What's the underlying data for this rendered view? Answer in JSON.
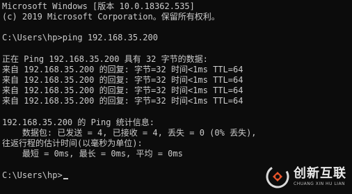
{
  "terminal": {
    "header_line_1": "Microsoft Windows [版本 10.0.18362.535]",
    "header_line_2": "(c) 2019 Microsoft Corporation。保留所有权利。",
    "command_line": "C:\\Users\\hp>ping 192.168.35.200",
    "ping_start": "正在 Ping 192.168.35.200 具有 32 字节的数据:",
    "replies": [
      "来自 192.168.35.200 的回复: 字节=32 时间<1ms TTL=64",
      "来自 192.168.35.200 的回复: 字节=32 时间<1ms TTL=64",
      "来自 192.168.35.200 的回复: 字节=32 时间<1ms TTL=64",
      "来自 192.168.35.200 的回复: 字节=32 时间<1ms TTL=64"
    ],
    "stats_header": "192.168.35.200 的 Ping 统计信息:",
    "stats_packets": "    数据包: 已发送 = 4, 已接收 = 4, 丢失 = 0 (0% 丢失),",
    "rtt_header": "往返行程的估计时间(以毫秒为单位):",
    "rtt_values": "    最短 = 0ms, 最长 = 0ms, 平均 = 0ms",
    "prompt": "C:\\Users\\hp>"
  },
  "watermark": {
    "name": "创新互联",
    "pinyin": "CHUANG XIN HU LIAN",
    "icon": "brand-logo-icon"
  },
  "colors": {
    "background": "#0c0c0c",
    "foreground": "#cccccc"
  }
}
